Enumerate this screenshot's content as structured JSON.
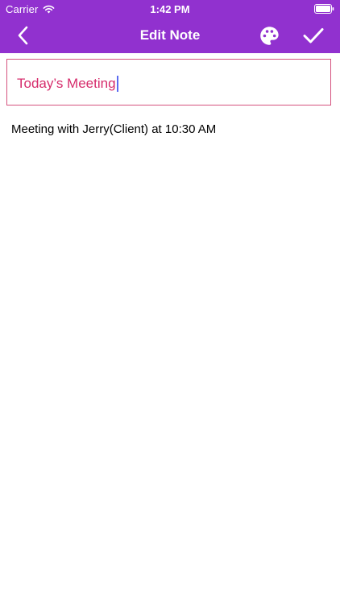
{
  "status_bar": {
    "carrier": "Carrier",
    "time": "1:42 PM"
  },
  "nav": {
    "title": "Edit Note",
    "back_icon": "chevron-left-icon",
    "palette_icon": "palette-icon",
    "done_icon": "checkmark-icon",
    "background_color": "#9131CF"
  },
  "note": {
    "title": "Today’s Meeting",
    "body": "Meeting with Jerry(Client) at 10:30 AM",
    "title_color": "#D62C6C",
    "field_border_color": "#D4537E"
  }
}
